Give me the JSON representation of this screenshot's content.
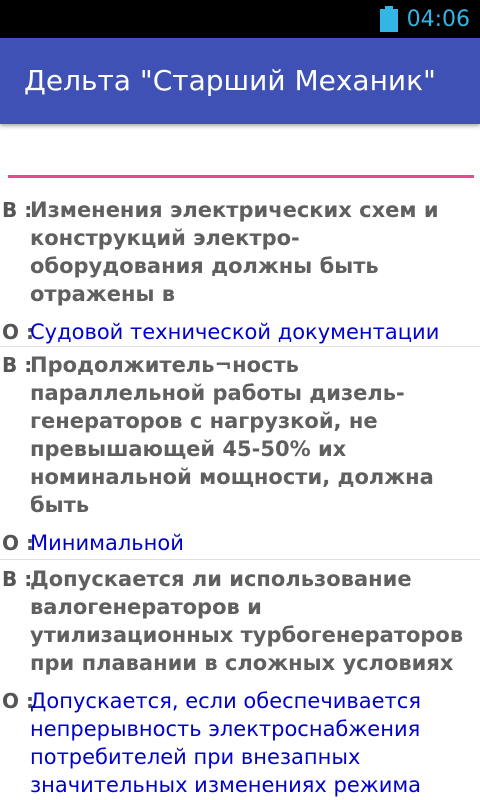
{
  "status_bar": {
    "time": "04:06",
    "battery_icon": "battery-charging-icon",
    "accent_color": "#33b5e5"
  },
  "app_bar": {
    "title": "Дельта \"Старший Механик\"",
    "background_color": "#3f51b5"
  },
  "search": {
    "value": "",
    "placeholder": "",
    "underline_color": "#e84a8c"
  },
  "labels": {
    "question_prefix": "В :",
    "answer_prefix": "О :"
  },
  "items": [
    {
      "question": "Изменения электрических схем и конструкций электро-оборудования должны быть отражены в",
      "answer": "Судовой технической документации"
    },
    {
      "question": "Продолжитель¬ность параллельной работы дизель-генераторов с нагрузкой, не превышающей 45-50% их номинальной мощности, должна быть",
      "answer": "Минимальной"
    },
    {
      "question": "Допускается ли использование валогенераторов и утилизационных турбогенераторов при плавании в сложных условиях",
      "answer": "Допускается, если обеспечивается непрерывность электроснабжения потребителей при внезапных значительных изменениях режима"
    }
  ]
}
